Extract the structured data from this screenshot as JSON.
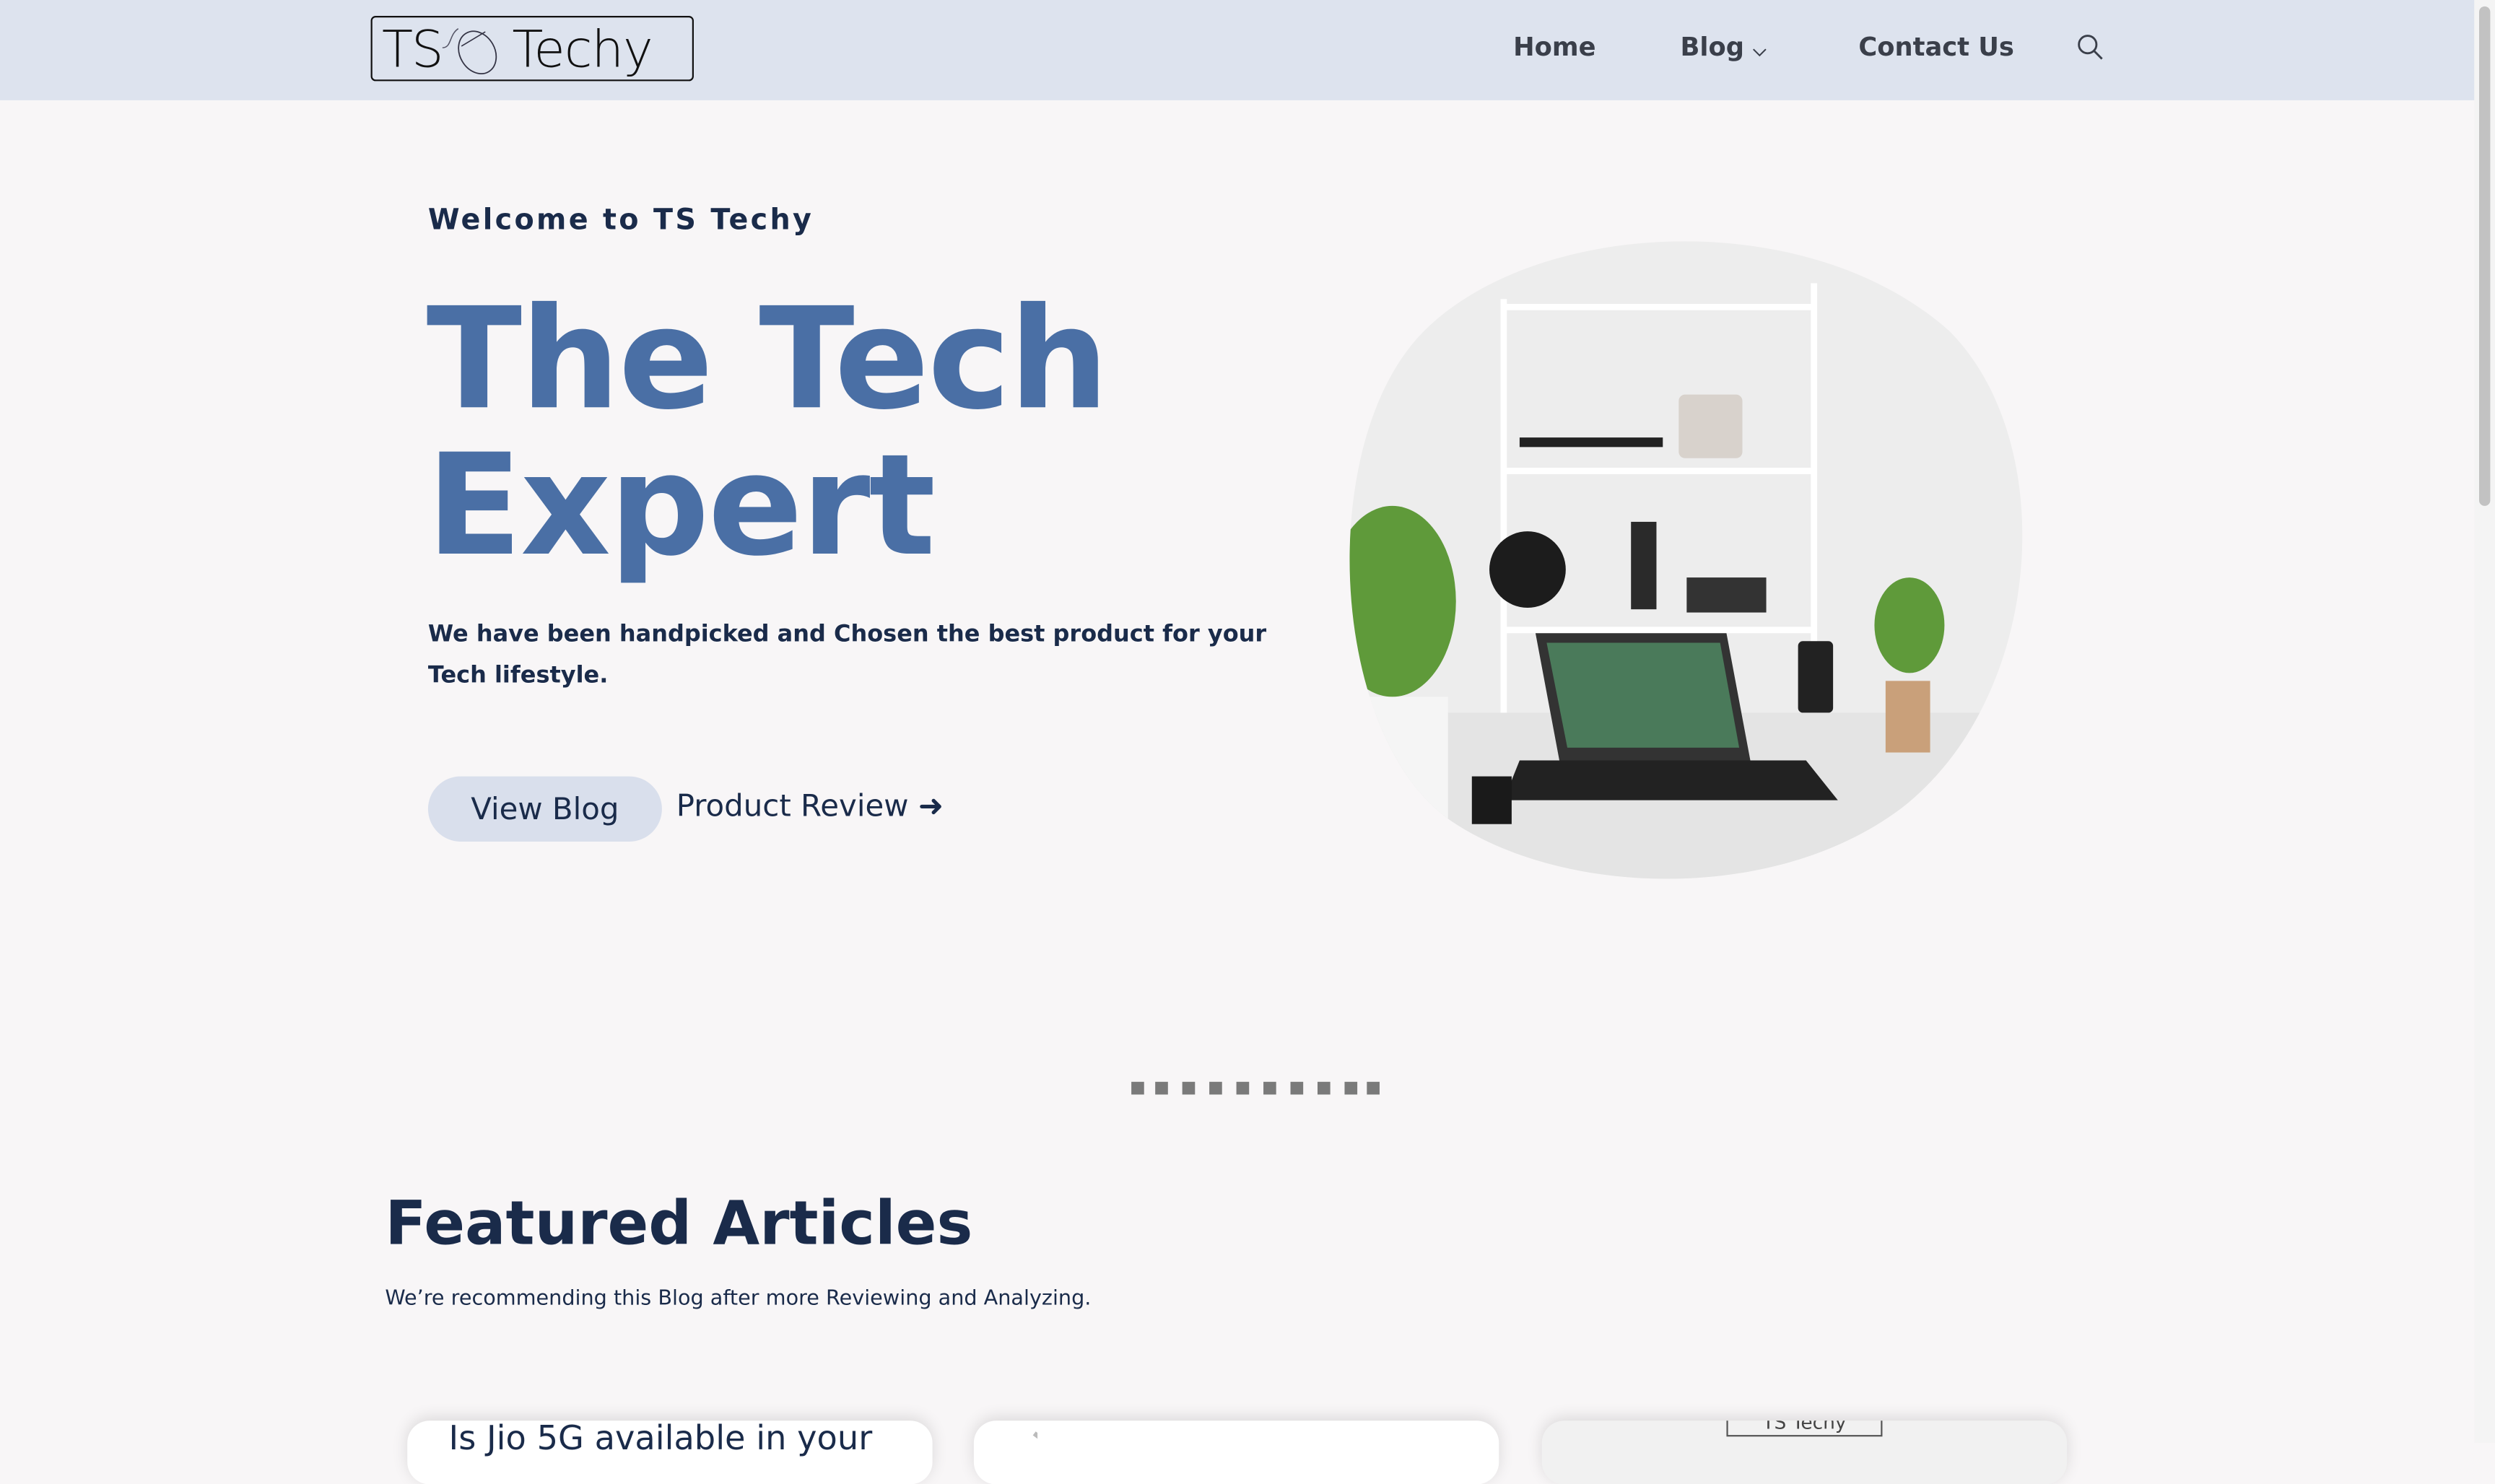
{
  "nav": {
    "logo_left": "TS",
    "logo_right": "Techy",
    "items": [
      {
        "label": "Home"
      },
      {
        "label": "Blog"
      },
      {
        "label": "Contact Us"
      }
    ]
  },
  "hero": {
    "welcome": "Welcome to TS Techy",
    "title_line1": "The Tech",
    "title_line2": "Expert",
    "subtitle": "We have been handpicked and Chosen the best product for your Tech lifestyle.",
    "primary_button": "View Blog",
    "secondary_link": "Product Review"
  },
  "slider": {
    "dot_count": 10
  },
  "featured": {
    "title": "Featured Articles",
    "subtitle": "We’re recommending this Blog after more Reviewing and Analyzing.",
    "cards": [
      {
        "title": "Is Jio 5G available in your"
      },
      {
        "title": ""
      },
      {
        "title": "TS Techy"
      }
    ]
  },
  "colors": {
    "nav_bg": "#dde3ee",
    "accent": "#4a6fa5",
    "navy": "#1a2b4a",
    "page_bg": "#f8f6f7"
  }
}
